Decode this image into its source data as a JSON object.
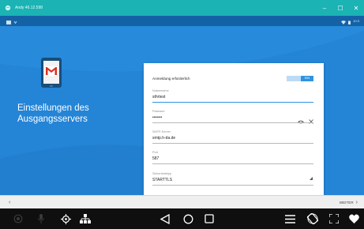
{
  "window": {
    "title": "Andy 46.12.598",
    "controls": {
      "minimize": "–",
      "maximize": "☐",
      "close": "✕"
    }
  },
  "statusbar": {
    "time": "10:3"
  },
  "page": {
    "heading": "Einstellungen des Ausgangsservers"
  },
  "form": {
    "auth_label": "Anmeldung erforderlich",
    "auth_toggle": "EIN",
    "auth_enabled": true,
    "fields": [
      {
        "label": "Nutzername",
        "value": "sthrtest"
      },
      {
        "label": "Passwort",
        "value": "•••••••"
      },
      {
        "label": "SMTP-Server",
        "value": "smtp.h-da.de"
      },
      {
        "label": "Port",
        "value": "587"
      },
      {
        "label": "Sicherheitstyp",
        "value": "STARTTLS"
      }
    ]
  },
  "navigation": {
    "back_glyph": "‹",
    "next_label": "WEITER",
    "next_glyph": "›"
  },
  "colors": {
    "titlebar": "#1bb3b3",
    "statusbar": "#1462a6",
    "app_background": "#2484d6",
    "accent": "#2f93e0",
    "gmail_red": "#d93025"
  }
}
